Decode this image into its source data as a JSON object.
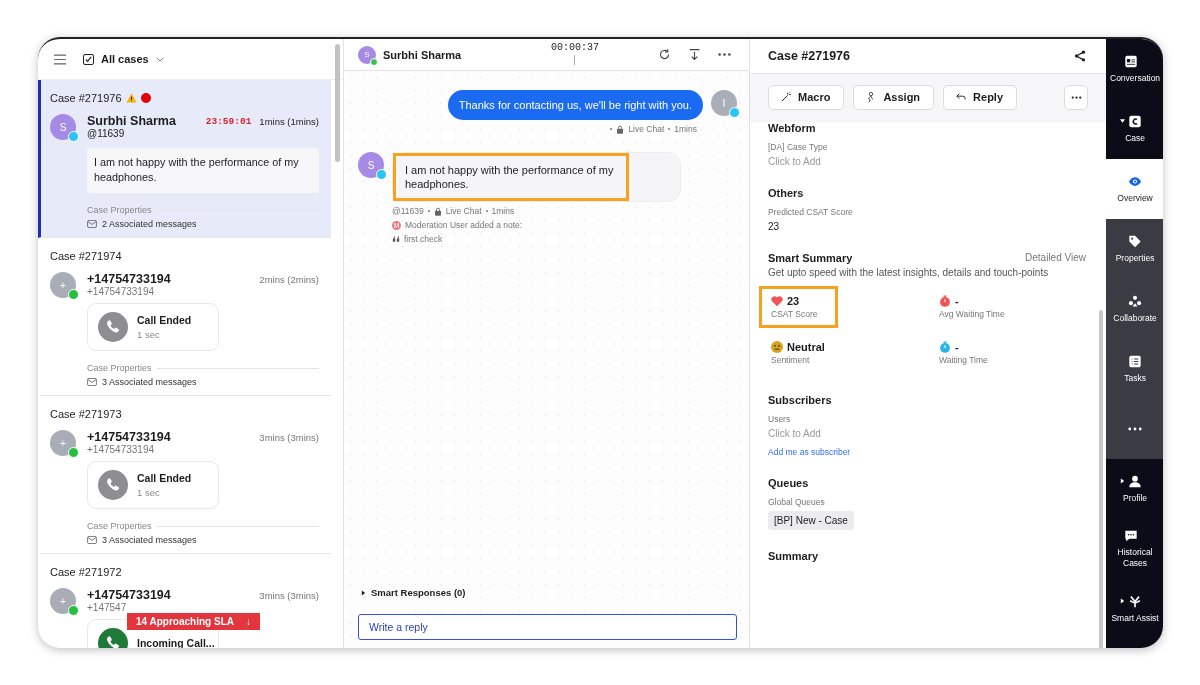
{
  "case_list": {
    "filter": {
      "label": "All cases",
      "checked": true
    },
    "cases": [
      {
        "case_id": "Case #271976",
        "warning": true,
        "alert": true,
        "selected": true,
        "avatar": "S",
        "channel_badge": {
          "color": "#29c5f6"
        },
        "name": "Surbhi Sharma",
        "handle": "@11639",
        "timer": "23:59:01",
        "age": "1mins (1mins)",
        "kind": "message",
        "message": "I am not happy with the performance of my headphones.",
        "properties": "Case Properties",
        "associated": "2 Associated messages"
      },
      {
        "case_id": "Case #271974",
        "warning": false,
        "alert": false,
        "selected": false,
        "avatar": "+",
        "channel_badge": {
          "color": "#25c03d"
        },
        "name": "+14754733194",
        "handle": "+14754733194",
        "age": "2mins (2mins)",
        "kind": "call",
        "call": {
          "title": "Call Ended",
          "duration": "1 sec",
          "incoming": false
        },
        "properties": "Case Properties",
        "associated": "3 Associated messages"
      },
      {
        "case_id": "Case #271973",
        "warning": false,
        "alert": false,
        "selected": false,
        "avatar": "+",
        "channel_badge": {
          "color": "#25c03d"
        },
        "name": "+14754733194",
        "handle": "+14754733194",
        "age": "3mins (3mins)",
        "kind": "call",
        "call": {
          "title": "Call Ended",
          "duration": "1 sec",
          "incoming": false
        },
        "properties": "Case Properties",
        "associated": "3 Associated messages"
      },
      {
        "case_id": "Case #271972",
        "warning": false,
        "alert": false,
        "selected": false,
        "avatar": "+",
        "channel_badge": {
          "color": "#25c03d"
        },
        "name": "+14754733194",
        "handle": "+147547",
        "age": "3mins (3mins)",
        "kind": "call",
        "call": {
          "title": "Incoming Call...",
          "incoming": true
        }
      }
    ],
    "sla_badge": {
      "label": "14 Approaching SLA",
      "arrow": "↓"
    }
  },
  "chat": {
    "header": {
      "avatar": "S",
      "online": true,
      "name": "Surbhi Sharma",
      "timer": "00:00:37"
    },
    "messages": [
      {
        "kind": "outgoing",
        "avatar": "I",
        "text": "Thanks for contacting us, we'll be right with you.",
        "channel": "Live Chat",
        "time": "1mins"
      },
      {
        "kind": "incoming",
        "avatar": "S",
        "text": "I am not happy with the performance of my headphones.",
        "highlighted": true,
        "handle": "@11639",
        "channel": "Live Chat",
        "time": "1mins",
        "note": {
          "badge": "M",
          "text": "Moderation User added a note:",
          "quote": "first check"
        }
      }
    ],
    "smart_responses": {
      "label": "Smart Responses (0)",
      "expanded": false
    },
    "reply": {
      "placeholder": "Write a reply"
    }
  },
  "details": {
    "title": "Case #271976",
    "actions": [
      "Macro",
      "Assign",
      "Reply"
    ],
    "sections": [
      {
        "title": "Webform",
        "fields": [
          {
            "label": "[DA] Case Type",
            "placeholder": "Click to Add"
          }
        ]
      },
      {
        "title": "Others",
        "fields": [
          {
            "label": "Predicted CSAT Score",
            "value": "23"
          }
        ]
      }
    ],
    "smart_summary": {
      "title": "Smart Summary",
      "link": "Detailed View",
      "subtitle": "Get upto speed with the latest insights, details and touch-points",
      "metrics": [
        {
          "kind": "heart",
          "value": "23",
          "label": "CSAT Score",
          "highlighted": true
        },
        {
          "kind": "timer-red",
          "value": "-",
          "label": "Avg Waiting Time",
          "highlighted": false
        },
        {
          "kind": "face",
          "value": "Neutral",
          "label": "Sentiment",
          "highlighted": false
        },
        {
          "kind": "timer-blue",
          "value": "-",
          "label": "Waiting Time",
          "highlighted": false
        }
      ]
    },
    "subscribers": {
      "title": "Subscribers",
      "label": "Users",
      "placeholder": "Click to Add",
      "link": "Add me as subscriber"
    },
    "queues": {
      "title": "Queues",
      "label": "Global Queues",
      "chip": "[BP] New - Case"
    },
    "summary": {
      "title": "Summary"
    }
  },
  "rail": [
    {
      "kind": "conversation",
      "label": "Conversation",
      "selected": false
    },
    {
      "kind": "case",
      "label": "Case",
      "selected": false,
      "expanded": true,
      "children": [
        {
          "kind": "overview",
          "label": "Overview",
          "selected": true
        },
        {
          "kind": "properties",
          "label": "Properties",
          "selected": false
        },
        {
          "kind": "collaborate",
          "label": "Collaborate",
          "selected": false
        },
        {
          "kind": "tasks",
          "label": "Tasks",
          "selected": false
        },
        {
          "kind": "more",
          "selected": false
        }
      ]
    },
    {
      "kind": "profile",
      "label": "Profile",
      "selected": false,
      "expanded": false
    },
    {
      "kind": "history",
      "label": "Historical Cases",
      "selected": false
    },
    {
      "kind": "assist",
      "label": "Smart Assist",
      "selected": false,
      "expanded": false
    }
  ]
}
